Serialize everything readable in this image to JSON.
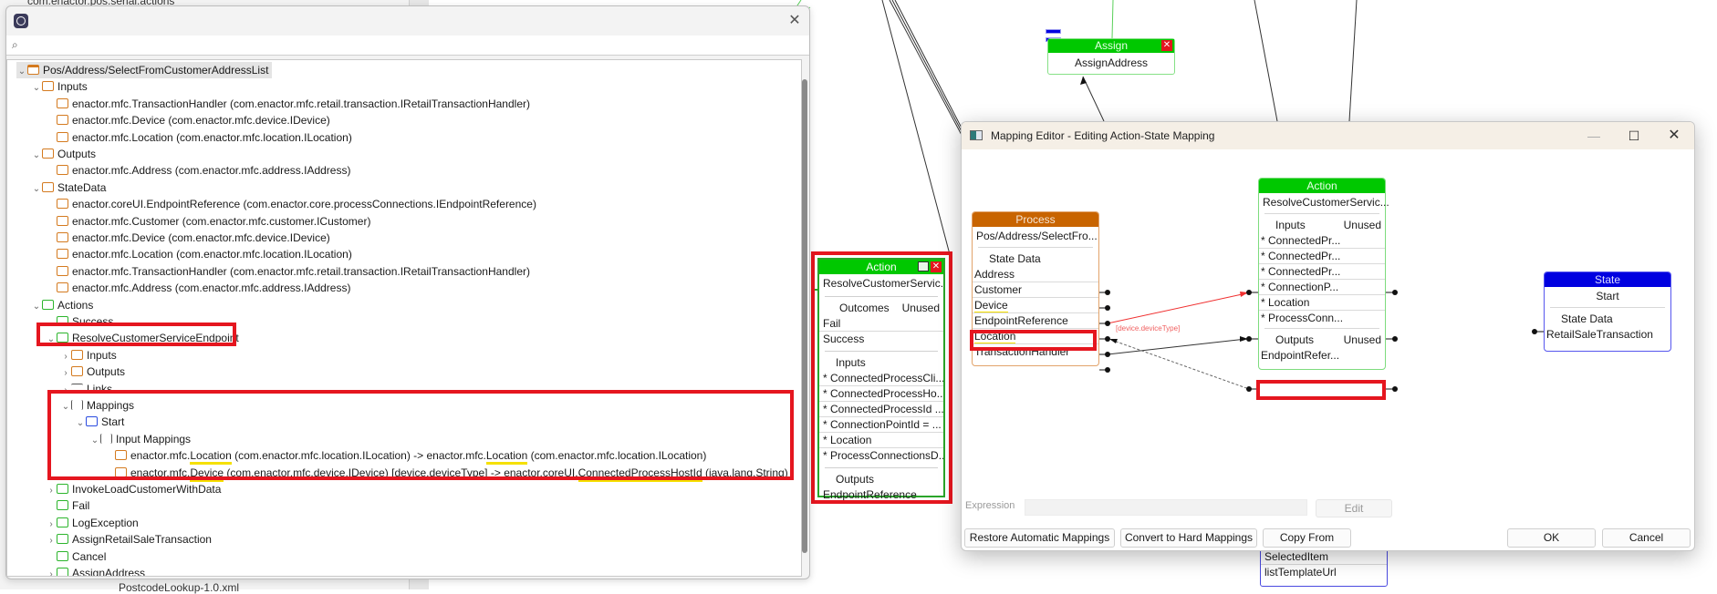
{
  "background": {
    "tree_peek_top": "com.enactor.pos.serial.actions",
    "tree_peek_bottom": "PostcodeLookup-1.0.xml"
  },
  "outline": {
    "search_placeholder": "",
    "close_icon": "close-icon",
    "tree": [
      {
        "label": "Pos/Address/SelectFromCustomerAddressList",
        "level": 0,
        "icon": "process-icon",
        "expanded": true
      },
      {
        "label": "Inputs",
        "level": 1,
        "icon": "input-icon",
        "expanded": true
      },
      {
        "label": "enactor.mfc.TransactionHandler (com.enactor.mfc.retail.transaction.IRetailTransactionHandler)",
        "level": 2,
        "icon": "input-icon"
      },
      {
        "label": "enactor.mfc.Device (com.enactor.mfc.device.IDevice)",
        "level": 2,
        "icon": "input-icon"
      },
      {
        "label": "enactor.mfc.Location (com.enactor.mfc.location.ILocation)",
        "level": 2,
        "icon": "input-icon"
      },
      {
        "label": "Outputs",
        "level": 1,
        "icon": "output-icon",
        "expanded": true
      },
      {
        "label": "enactor.mfc.Address (com.enactor.mfc.address.IAddress)",
        "level": 2,
        "icon": "output-icon"
      },
      {
        "label": "StateData",
        "level": 1,
        "icon": "state-data-icon",
        "expanded": true
      },
      {
        "label": "enactor.coreUI.EndpointReference (com.enactor.core.processConnections.IEndpointReference)",
        "level": 2,
        "icon": "state-data-icon"
      },
      {
        "label": "enactor.mfc.Customer (com.enactor.mfc.customer.ICustomer)",
        "level": 2,
        "icon": "state-data-icon"
      },
      {
        "label": "enactor.mfc.Device (com.enactor.mfc.device.IDevice)",
        "level": 2,
        "icon": "state-data-icon"
      },
      {
        "label": "enactor.mfc.Location (com.enactor.mfc.location.ILocation)",
        "level": 2,
        "icon": "state-data-icon"
      },
      {
        "label": "enactor.mfc.TransactionHandler (com.enactor.mfc.retail.transaction.IRetailTransactionHandler)",
        "level": 2,
        "icon": "state-data-icon"
      },
      {
        "label": "enactor.mfc.Address (com.enactor.mfc.address.IAddress)",
        "level": 2,
        "icon": "state-data-icon"
      },
      {
        "label": "Actions",
        "level": 1,
        "icon": "actions-icon",
        "expanded": true
      },
      {
        "label": "Success",
        "level": 2,
        "icon": "action-icon"
      },
      {
        "label": "ResolveCustomerServiceEndpoint",
        "level": 2,
        "icon": "action-icon",
        "expanded": true
      },
      {
        "label": "Inputs",
        "level": 3,
        "icon": "input-icon",
        "collapsed": true
      },
      {
        "label": "Outputs",
        "level": 3,
        "icon": "output-icon",
        "collapsed": true
      },
      {
        "label": "Links",
        "level": 3,
        "icon": "links-icon",
        "collapsed": true
      },
      {
        "label": "Mappings",
        "level": 3,
        "icon": "mappings-icon",
        "expanded": true
      },
      {
        "label": "Start",
        "level": 4,
        "icon": "start-state-icon",
        "expanded": true
      },
      {
        "label": "Input Mappings",
        "level": 5,
        "icon": "mappings-icon",
        "expanded": true
      },
      {
        "label": "enactor.mfc.Location (com.enactor.mfc.location.ILocation) -> enactor.mfc.Location (com.enactor.mfc.location.ILocation)",
        "level": 6,
        "icon": "mapping-item-icon"
      },
      {
        "label": "enactor.mfc.Device (com.enactor.mfc.device.IDevice) [device.deviceType] -> enactor.coreUI.ConnectedProcessHostId (java.lang.String)",
        "level": 6,
        "icon": "mapping-item-icon"
      },
      {
        "label": "InvokeLoadCustomerWithData",
        "level": 2,
        "icon": "action-icon",
        "collapsed": true
      },
      {
        "label": "Fail",
        "level": 2,
        "icon": "action-icon"
      },
      {
        "label": "LogException",
        "level": 2,
        "icon": "action-icon",
        "collapsed": true
      },
      {
        "label": "AssignRetailSaleTransaction",
        "level": 2,
        "icon": "action-icon",
        "collapsed": true
      },
      {
        "label": "Cancel",
        "level": 2,
        "icon": "action-icon"
      },
      {
        "label": "AssignAddress",
        "level": 2,
        "icon": "action-icon",
        "collapsed": true
      }
    ],
    "mapping1": {
      "p1": "enactor.mfc.",
      "h1": "Location",
      "p2": " (com.enactor.mfc.location.ILocation) -> enactor.mfc.",
      "h2": "Location",
      "p3": " (com.enactor.mfc.location.ILocation)"
    },
    "mapping2": {
      "p1": "enactor.mfc.",
      "h1": "Device",
      "p2": " (com.enactor.mfc.device.IDevice) [device.deviceType] -> enactor.coreUI.",
      "h2": "ConnectedProcessHostId",
      "p3": " (java.lang.String)"
    }
  },
  "canvas": {
    "assign_node": {
      "header": "Assign",
      "name": "AssignAddress"
    },
    "action_node": {
      "header": "Action",
      "name": "ResolveCustomerServic...",
      "outcomes_label": "Outcomes",
      "unused_label": "Unused",
      "outcomes": [
        "Fail",
        "Success"
      ],
      "inputs_label": "Inputs",
      "inputs": [
        "* ConnectedProcessCli...",
        "* ConnectedProcessHo...",
        "* ConnectedProcessId ...",
        "* ConnectionPointId = ...",
        "* Location",
        "* ProcessConnectionsD..."
      ],
      "outputs_label": "Outputs",
      "outputs": [
        "EndpointReference"
      ]
    },
    "peek_node_rows": [
      "SelectedItem",
      "listTemplateUrl"
    ]
  },
  "mapping_editor": {
    "title": "Mapping Editor - Editing Action-State Mapping",
    "minimize": "—",
    "maximize": "☐",
    "close": "✕",
    "process_node": {
      "header": "Process",
      "name": "Pos/Address/SelectFro...",
      "section": "State Data",
      "rows": [
        "Address",
        "Customer",
        "Device",
        "EndpointReference",
        "Location",
        "TransactionHandler"
      ]
    },
    "action_node": {
      "header": "Action",
      "name": "ResolveCustomerServic...",
      "inputs_label": "Inputs",
      "unused_label": "Unused",
      "inputs": [
        "* ConnectedPr...",
        "* ConnectedPr...",
        "* ConnectedPr...",
        "* ConnectionP...",
        "* Location",
        "* ProcessConn..."
      ],
      "outputs_label": "Outputs",
      "outputs_unused": "Unused",
      "outputs": [
        "EndpointRefer..."
      ]
    },
    "state_node": {
      "header": "State",
      "name": "Start",
      "section": "State Data",
      "rows": [
        "RetailSaleTransaction"
      ]
    },
    "link_label": "[device.deviceType]",
    "expression_label": "Expression",
    "expression_value": "",
    "edit_button": "Edit",
    "buttons": {
      "restore": "Restore Automatic Mappings",
      "convert": "Convert to Hard Mappings",
      "copy": "Copy From",
      "ok": "OK",
      "cancel": "Cancel"
    },
    "colors": {
      "process": "#c86400",
      "action": "#00c800",
      "state": "#0000e0",
      "highlight_box": "#e5161f",
      "underline": "#f5e000",
      "link_red": "#f03030"
    }
  }
}
